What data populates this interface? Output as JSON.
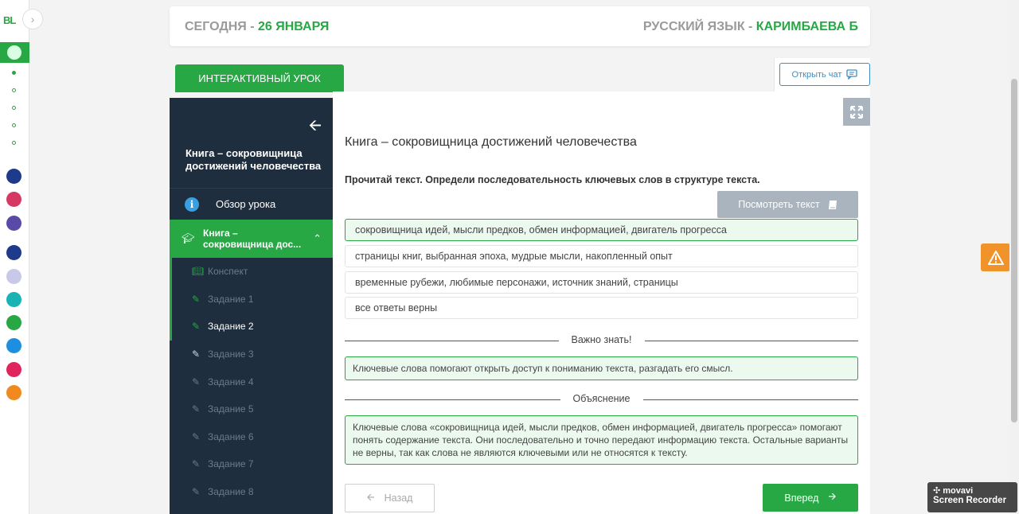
{
  "rail": {
    "logo": "BL",
    "toggle_icon": "chevron-right-icon",
    "app_colors": [
      "#1e3a8a",
      "#d63864",
      "#5a4aa8",
      "#1e3a8a",
      "#c8c8e8",
      "#1ab3b3",
      "#28a745",
      "#1e8fe0",
      "#e0245e",
      "#f08a1e"
    ]
  },
  "header": {
    "today_label": "СЕГОДНЯ - ",
    "date": "26 ЯНВАРЯ",
    "subject_label": "РУССКИЙ ЯЗЫК - ",
    "teacher": "КАРИМБАЕВА Б"
  },
  "tabs": {
    "interactive": "ИНТЕРАКТИВНЫЙ УРОК",
    "chat": "Открыть чат"
  },
  "sidebar": {
    "title": "Книга – сокровищница достижений человечества",
    "overview": "Обзор урока",
    "section": "Книга – сокровищница дос...",
    "items": [
      {
        "label": "Конспект",
        "icon": "book-icon"
      },
      {
        "label": "Задание 1",
        "icon": "edit-icon"
      },
      {
        "label": "Задание 2",
        "icon": "edit-icon"
      },
      {
        "label": "Задание 3",
        "icon": "edit-icon"
      },
      {
        "label": "Задание 4",
        "icon": "edit-icon"
      },
      {
        "label": "Задание 5",
        "icon": "edit-icon"
      },
      {
        "label": "Задание 6",
        "icon": "edit-icon"
      },
      {
        "label": "Задание 7",
        "icon": "edit-icon"
      },
      {
        "label": "Задание 8",
        "icon": "edit-icon"
      }
    ]
  },
  "main": {
    "title": "Книга – сокровищница достижений человечества",
    "instruction": "Прочитай текст. Определи последовательность ключевых слов в структуре текста.",
    "view_text": "Посмотреть текст",
    "answers": [
      "сокровищница идей, мысли предков, обмен информацией, двигатель прогресса",
      "страницы книг, выбранная эпоха, мудрые мысли, накопленный опыт",
      "временные рубежи, любимые персонажи, источник знаний, страницы",
      "все ответы верны"
    ],
    "important_label": "Важно знать!",
    "important_text": "Ключевые слова помогают открыть доступ к пониманию текста, разгадать его смысл.",
    "explanation_label": "Объяснение",
    "explanation_text": "Ключевые слова «сокровищница идей, мысли предков, обмен информацией, двигатель прогресса» помогают понять содержание текста. Они последовательно и точно передают информацию текста. Остальные варианты не верны, так как слова не являются ключевыми или не относятся к тексту.",
    "back": "Назад",
    "next": "Вперед"
  },
  "recorder": {
    "brand": "movavi",
    "product": "Screen Recorder"
  },
  "colors": {
    "accent": "#28a745",
    "sidebar": "#1e2e3e",
    "warning": "#f0932b"
  }
}
